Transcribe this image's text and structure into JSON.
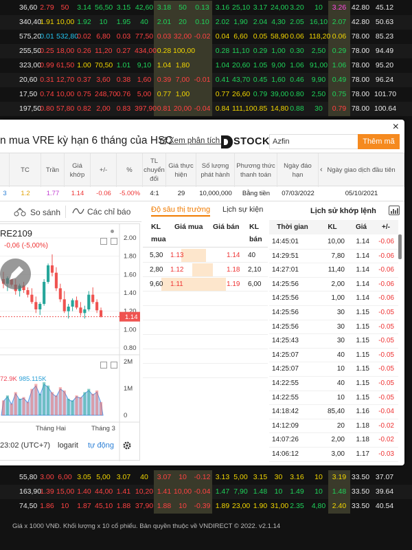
{
  "bg_rows_top": [
    [
      "36,60",
      "2.79",
      "50",
      "3.14",
      "56,50",
      "3.15",
      "42,60",
      "3.18",
      "50",
      "0.13",
      "3.16",
      "25,10",
      "3.17",
      "24,00",
      "3.20",
      "10",
      "3.26",
      "42.80",
      "45.12"
    ],
    [
      "340,40",
      "1.91",
      "10,00",
      "1.92",
      "10",
      "1.95",
      "40",
      "2.01",
      "20",
      "0.10",
      "2.02",
      "1,90",
      "2.04",
      "4,30",
      "2.05",
      "16,10",
      "2.07",
      "42.80",
      "50.63"
    ],
    [
      "575,20",
      "0.01",
      "532,80",
      "0.02",
      "6,80",
      "0.03",
      "77,50",
      "0.03",
      "32,00",
      "-0.02",
      "0.04",
      "6,60",
      "0.05",
      "58,90",
      "0.06",
      "118,20",
      "0.06",
      "78.00",
      "85.23"
    ],
    [
      "255,50",
      "0.25",
      "18,00",
      "0.26",
      "11,20",
      "0.27",
      "434,00",
      "0.28",
      "100,00",
      "",
      "0.28",
      "11,10",
      "0.29",
      "1,00",
      "0.30",
      "2,50",
      "0.29",
      "78.00",
      "94.49"
    ],
    [
      "323,00",
      "0.99",
      "61,50",
      "1.00",
      "70,50",
      "1.01",
      "9,10",
      "1.04",
      "1,80",
      "",
      "1.04",
      "20,60",
      "1.05",
      "9,00",
      "1.06",
      "91,00",
      "1.06",
      "78.00",
      "95.20"
    ],
    [
      "20,60",
      "0.31",
      "12,70",
      "0.37",
      "3,60",
      "0.38",
      "1,60",
      "0.39",
      "7,00",
      "-0.01",
      "0.41",
      "43,70",
      "0.45",
      "1,60",
      "0.46",
      "9,90",
      "0.49",
      "78.00",
      "96.24"
    ],
    [
      "17,50",
      "0.74",
      "10,00",
      "0.75",
      "248,70",
      "0.76",
      "5,00",
      "0.77",
      "1,00",
      "",
      "0.77",
      "26,60",
      "0.79",
      "39,00",
      "0.80",
      "2,50",
      "0.75",
      "78.00",
      "101.70"
    ],
    [
      "197,50",
      "0.80",
      "57,80",
      "0.82",
      "2,00",
      "0.83",
      "397,90",
      "0.81",
      "20,00",
      "-0.04",
      "0.84",
      "111,10",
      "0.85",
      "14,80",
      "0.88",
      "30",
      "0.79",
      "78.00",
      "100.64"
    ]
  ],
  "bg_rows_bottom": [
    [
      "55,80",
      "3.00",
      "6,00",
      "3.05",
      "5,00",
      "3.07",
      "40",
      "3.07",
      "10",
      "-0.12",
      "3.13",
      "5,00",
      "3.15",
      "30",
      "3.16",
      "10",
      "3.19",
      "33.50",
      "37.07"
    ],
    [
      "163,90",
      "1.39",
      "15,00",
      "1.40",
      "44,00",
      "1.41",
      "10,20",
      "1.41",
      "10,00",
      "-0.04",
      "1.47",
      "7,90",
      "1.48",
      "10",
      "1.49",
      "10",
      "1.48",
      "33.50",
      "39.64"
    ],
    [
      "74,50",
      "1.86",
      "10",
      "1.87",
      "45,10",
      "1.88",
      "37,90",
      "1.88",
      "10",
      "-0.39",
      "1.89",
      "23,00",
      "1.90",
      "31,00",
      "2.35",
      "4,80",
      "2.40",
      "33.50",
      "40.54"
    ]
  ],
  "footer_text": "Giá x 1000 VNĐ. Khối lượng x 10 cổ phiếu. Bản quyền thuộc về VNDIRECT © 2022. v2.1.14",
  "modal": {
    "close": "×",
    "title": "n mua VRE kỳ hạn 6 tháng của HSC",
    "analysis_link": "Xem phân tích tại",
    "logo_text": "STOCK",
    "search_value": "Azfin",
    "add_button": "Thêm mã",
    "table": {
      "headers": [
        "TC",
        "Trần",
        "Giá khớp",
        "+/-",
        "%",
        "TL chuyển đổi",
        "Giá thực hiện",
        "Số lượng phát hành",
        "Phương thức thanh toán",
        "Ngày đáo hạn",
        "Ngày giao dịch đầu tiên"
      ],
      "row": {
        "code": "3",
        "tc": "1.2",
        "tran": "1.77",
        "gia_khop": "1.14",
        "change": "-0.06",
        "percent": "-5.00%",
        "tl": "4:1",
        "gia_th": "29",
        "so_luong": "10,000,000",
        "phuong_thuc": "Bằng tiền",
        "ngay_dao_han": "07/03/2022",
        "ngay_gd": "05/10/2021"
      }
    },
    "chart": {
      "tab_compare": "So sánh",
      "tab_indicators": "Các chỉ báo",
      "symbol": "RE2109",
      "change_text": "-0,06 (-5,00%)",
      "vol1": "72.9K",
      "vol2": "985.115K",
      "time": "23:02 (UTC+7)",
      "logarit": "logarit",
      "auto": "tự động",
      "last_price_tag": "1.14"
    },
    "depth": {
      "tab_active": "Độ sâu thị trường",
      "tab_events": "Lịch sự kiện",
      "head_kl": "KL",
      "head_mua": "mua",
      "head_gia_mua": "Giá mua",
      "head_gia_ban": "Giá bán",
      "head_kl_ban": "KL",
      "head_ban": "bán",
      "rows": [
        {
          "kl_mua": "5,30",
          "gia_mua": "1.13",
          "gia_ban": "1.14",
          "kl_ban": "40",
          "mua_ratio": 0.55,
          "ban_ratio": 0.02
        },
        {
          "kl_mua": "2,80",
          "gia_mua": "1.12",
          "gia_ban": "1.18",
          "kl_ban": "2,10",
          "mua_ratio": 0.29,
          "ban_ratio": 0.35
        },
        {
          "kl_mua": "9,60",
          "gia_mua": "1.11",
          "gia_ban": "1.19",
          "kl_ban": "6,00",
          "mua_ratio": 1.0,
          "ban_ratio": 1.0
        }
      ]
    },
    "history": {
      "title": "Lịch sử khớp lệnh",
      "headers": [
        "Thời gian",
        "KL",
        "Giá",
        "+/-"
      ],
      "rows": [
        [
          "14:45:01",
          "10,00",
          "1.14",
          "-0.06"
        ],
        [
          "14:29:51",
          "7,80",
          "1.14",
          "-0.06"
        ],
        [
          "14:27:01",
          "11,40",
          "1.14",
          "-0.06"
        ],
        [
          "14:25:56",
          "2,00",
          "1.14",
          "-0.06"
        ],
        [
          "14:25:56",
          "1,00",
          "1.14",
          "-0.06"
        ],
        [
          "14:25:56",
          "30",
          "1.15",
          "-0.05"
        ],
        [
          "14:25:56",
          "30",
          "1.15",
          "-0.05"
        ],
        [
          "14:25:43",
          "30",
          "1.15",
          "-0.05"
        ],
        [
          "14:25:07",
          "40",
          "1.15",
          "-0.05"
        ],
        [
          "14:25:07",
          "10",
          "1.15",
          "-0.05"
        ],
        [
          "14:22:55",
          "40",
          "1.15",
          "-0.05"
        ],
        [
          "14:22:55",
          "10",
          "1.15",
          "-0.05"
        ],
        [
          "14:18:42",
          "85,40",
          "1.16",
          "-0.04"
        ],
        [
          "14:12:09",
          "20",
          "1.18",
          "-0.02"
        ],
        [
          "14:07:26",
          "2,00",
          "1.18",
          "-0.02"
        ],
        [
          "14:06:12",
          "3,00",
          "1.17",
          "-0.03"
        ]
      ]
    }
  },
  "chart_data": {
    "type": "candlestick",
    "y_ticks": [
      "2.00",
      "1.80",
      "1.60",
      "1.40",
      "1.20",
      "1.00",
      "0.80"
    ],
    "vol_ticks": [
      "2M",
      "1M",
      "0"
    ],
    "x_labels": [
      "Tháng Hai",
      "Tháng 3"
    ],
    "last_price": 1.14,
    "ylim": [
      0.8,
      2.0
    ],
    "candles": [
      [
        1.55,
        1.63,
        1.45,
        1.5
      ],
      [
        1.5,
        1.58,
        1.42,
        1.56
      ],
      [
        1.56,
        1.6,
        1.47,
        1.49
      ],
      [
        1.49,
        1.55,
        1.38,
        1.42
      ],
      [
        1.42,
        1.5,
        1.36,
        1.48
      ],
      [
        1.48,
        1.52,
        1.4,
        1.43
      ],
      [
        1.43,
        1.46,
        1.35,
        1.38
      ],
      [
        1.38,
        1.45,
        1.28,
        1.3
      ],
      [
        1.3,
        1.36,
        1.18,
        1.22
      ],
      [
        1.22,
        1.3,
        1.16,
        1.28
      ],
      [
        1.28,
        1.55,
        1.26,
        1.52
      ],
      [
        1.52,
        1.72,
        1.5,
        1.7
      ],
      [
        1.7,
        1.82,
        1.58,
        1.62
      ],
      [
        1.62,
        1.68,
        1.42,
        1.45
      ],
      [
        1.45,
        1.5,
        1.3,
        1.33
      ],
      [
        1.33,
        1.42,
        1.18,
        1.2
      ],
      [
        1.2,
        1.28,
        1.12,
        1.25
      ],
      [
        1.25,
        1.34,
        1.2,
        1.32
      ],
      [
        1.32,
        1.36,
        1.22,
        1.24
      ],
      [
        1.24,
        1.3,
        1.15,
        1.18
      ],
      [
        1.18,
        1.26,
        1.12,
        1.22
      ],
      [
        1.22,
        1.42,
        1.2,
        1.38
      ],
      [
        1.38,
        1.46,
        1.28,
        1.3
      ],
      [
        1.3,
        1.33,
        1.18,
        1.21
      ],
      [
        1.21,
        1.24,
        1.13,
        1.14
      ]
    ],
    "volumes": [
      0.45,
      0.6,
      0.35,
      0.7,
      0.5,
      0.55,
      0.4,
      0.8,
      0.95,
      0.65,
      1.0,
      0.9,
      0.7,
      0.6,
      0.85,
      0.75,
      0.5,
      0.45,
      0.6,
      0.55,
      0.7,
      0.8,
      0.65,
      0.75,
      0.4
    ]
  }
}
